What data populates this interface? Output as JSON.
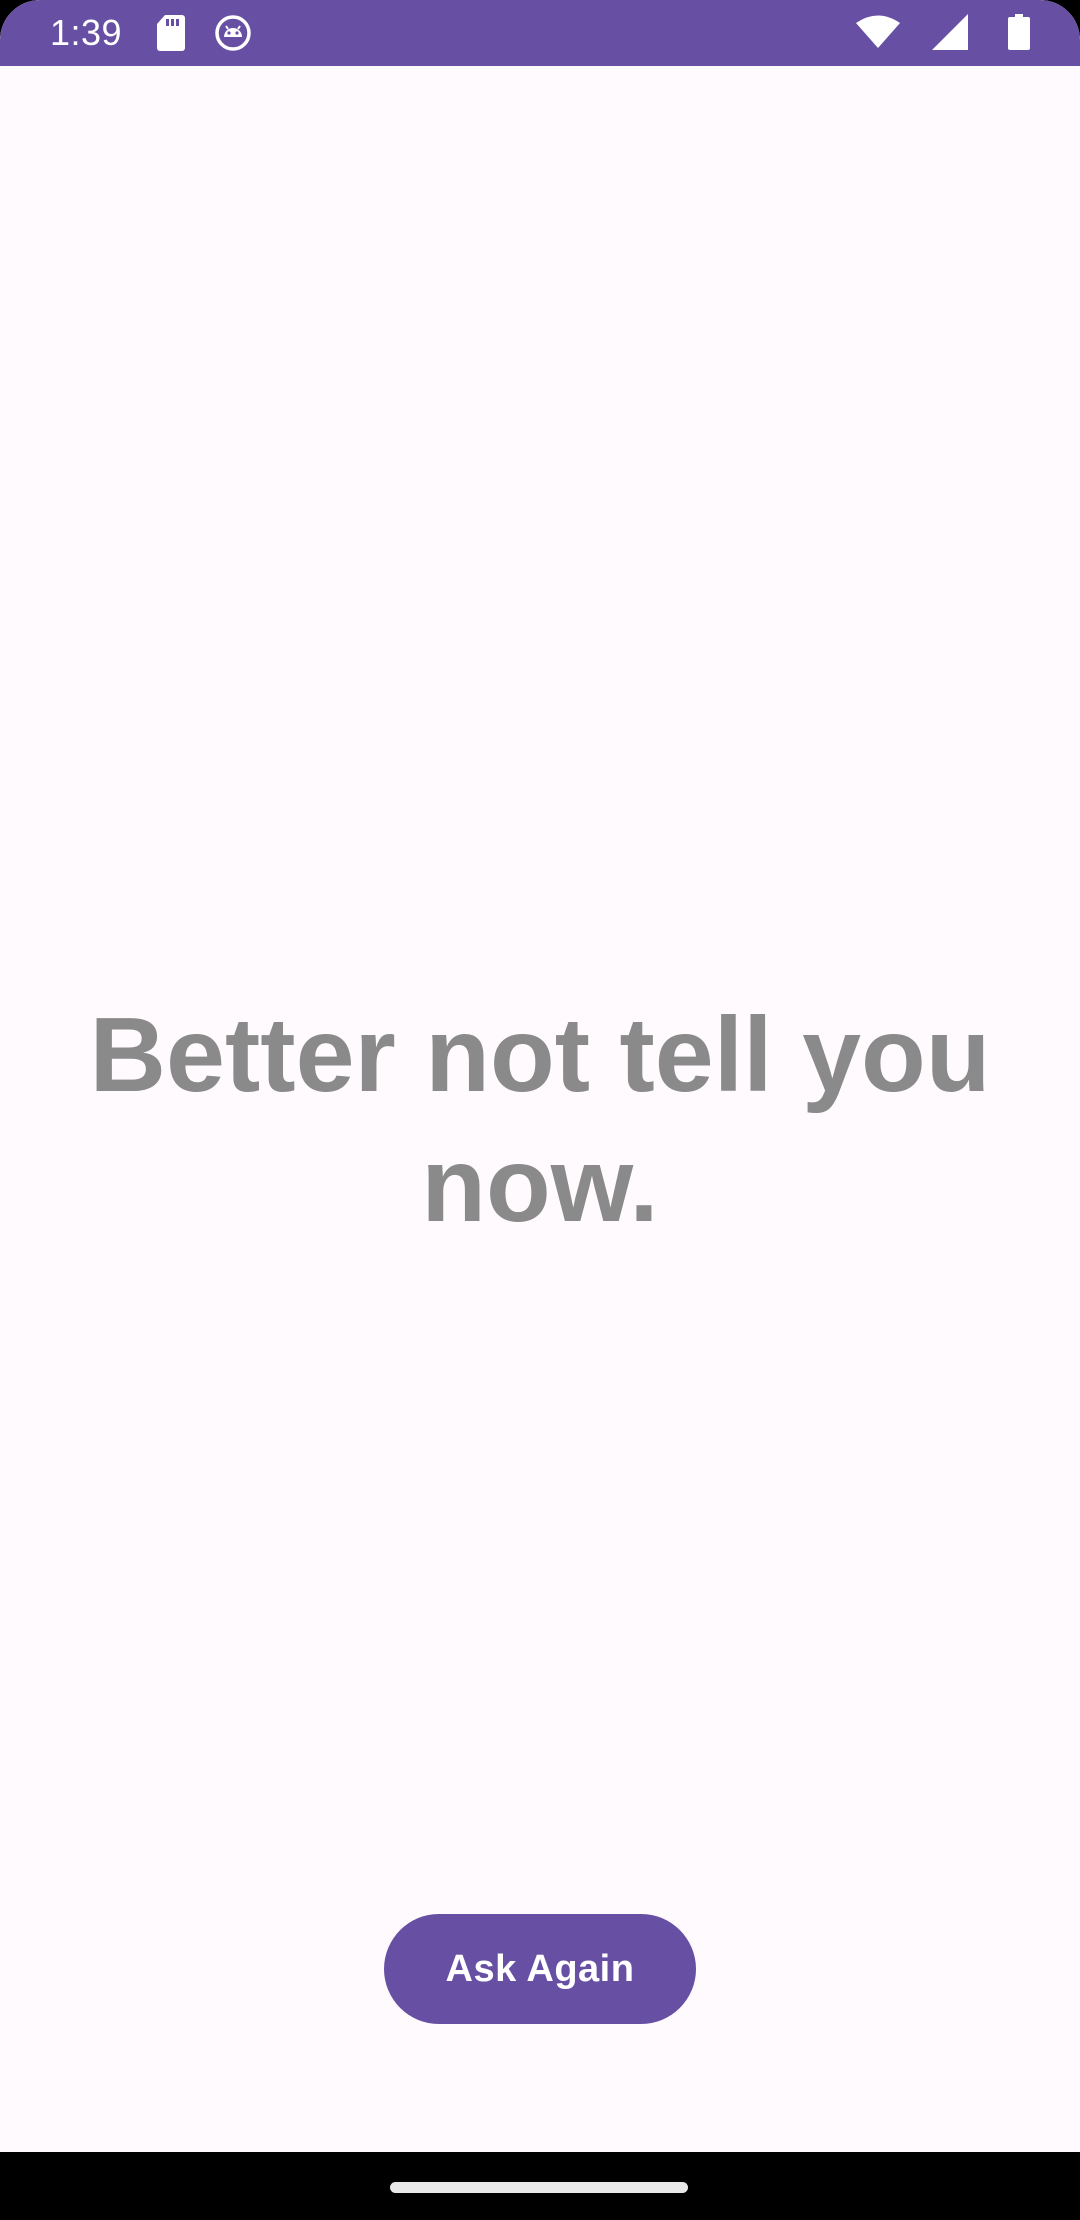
{
  "status_bar": {
    "time": "1:39",
    "left_icons": [
      "sd-card-icon",
      "android-debug-icon"
    ],
    "right_icons": [
      "wifi-icon",
      "cell-signal-icon",
      "battery-icon"
    ],
    "background_color": "#6750a4"
  },
  "main": {
    "answer": "Better not tell you now.",
    "button_label": "Ask Again"
  },
  "colors": {
    "primary": "#6750a4",
    "answer_text": "#8a8a8a",
    "background": "#fefafd"
  }
}
